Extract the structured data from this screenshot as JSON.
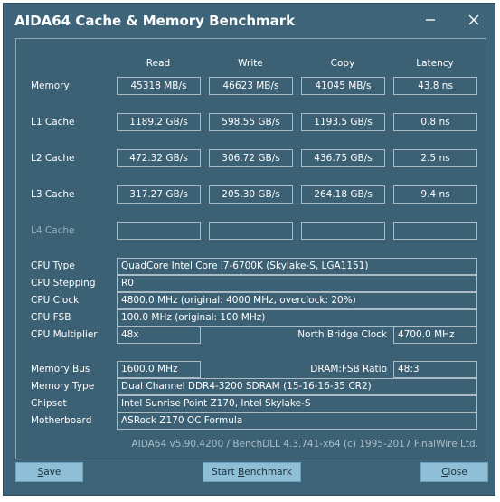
{
  "window": {
    "title": "AIDA64 Cache & Memory Benchmark"
  },
  "columns": [
    "Read",
    "Write",
    "Copy",
    "Latency"
  ],
  "rows": [
    {
      "label": "Memory",
      "values": [
        "45318 MB/s",
        "46623 MB/s",
        "41045 MB/s",
        "43.8 ns"
      ]
    },
    {
      "label": "L1 Cache",
      "values": [
        "1189.2 GB/s",
        "598.55 GB/s",
        "1193.5 GB/s",
        "0.8 ns"
      ]
    },
    {
      "label": "L2 Cache",
      "values": [
        "472.32 GB/s",
        "306.72 GB/s",
        "436.75 GB/s",
        "2.5 ns"
      ]
    },
    {
      "label": "L3 Cache",
      "values": [
        "317.27 GB/s",
        "205.30 GB/s",
        "264.18 GB/s",
        "9.4 ns"
      ]
    },
    {
      "label": "L4 Cache",
      "values": [
        "",
        "",
        "",
        ""
      ]
    }
  ],
  "info": {
    "cpu_type_label": "CPU Type",
    "cpu_type": "QuadCore Intel Core i7-6700K  (Skylake-S, LGA1151)",
    "cpu_stepping_label": "CPU Stepping",
    "cpu_stepping": "R0",
    "cpu_clock_label": "CPU Clock",
    "cpu_clock": "4800.0 MHz  (original: 4000 MHz, overclock: 20%)",
    "cpu_fsb_label": "CPU FSB",
    "cpu_fsb": "100.0 MHz  (original: 100 MHz)",
    "cpu_multiplier_label": "CPU Multiplier",
    "cpu_multiplier": "48x",
    "north_bridge_label": "North Bridge Clock",
    "north_bridge": "4700.0 MHz",
    "memory_bus_label": "Memory Bus",
    "memory_bus": "1600.0 MHz",
    "dram_fsb_label": "DRAM:FSB Ratio",
    "dram_fsb": "48:3",
    "memory_type_label": "Memory Type",
    "memory_type": "Dual Channel DDR4-3200 SDRAM  (15-16-16-35 CR2)",
    "chipset_label": "Chipset",
    "chipset": "Intel Sunrise Point Z170, Intel Skylake-S",
    "motherboard_label": "Motherboard",
    "motherboard": "ASRock Z170 OC Formula"
  },
  "footer": "AIDA64 v5.90.4200 / BenchDLL 4.3.741-x64  (c) 1995-2017 FinalWire Ltd.",
  "buttons": {
    "save": {
      "mnemonic": "S",
      "rest": "ave"
    },
    "start": {
      "before": "Start ",
      "mnemonic": "B",
      "rest": "enchmark"
    },
    "close": {
      "mnemonic": "C",
      "rest": "lose"
    }
  },
  "icons": {
    "minimize": "minimize-icon",
    "close": "close-icon"
  }
}
